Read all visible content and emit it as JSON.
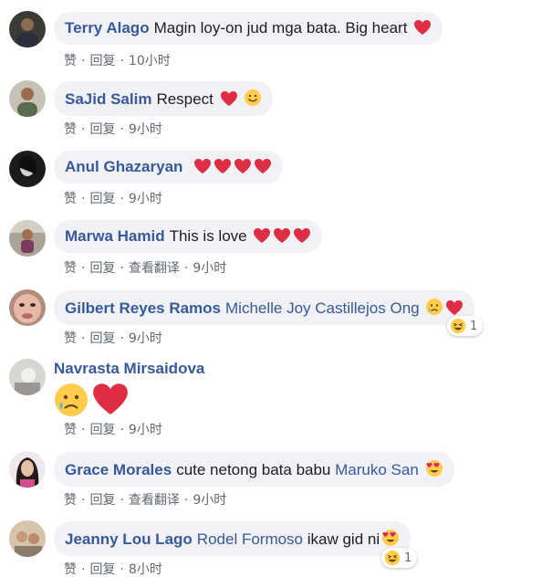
{
  "actions": {
    "like": "赞",
    "reply": "回复",
    "translate": "查看翻译",
    "sep": "·"
  },
  "comments": [
    {
      "author": "Terry Alago",
      "text": "Magin loy-on jud mga bata. Big heart",
      "emojis": [
        "heart"
      ],
      "time": "10小时"
    },
    {
      "author": "SaJid Salim",
      "text": "Respect",
      "emojis": [
        "heart",
        "smile"
      ],
      "time": "9小时"
    },
    {
      "author": "Anul Ghazaryan",
      "text": "",
      "emojis": [
        "heart",
        "heart",
        "heart",
        "heart"
      ],
      "time": "9小时"
    },
    {
      "author": "Marwa Hamid",
      "text": "This is love",
      "emojis": [
        "heart",
        "heart",
        "heart"
      ],
      "time": "9小时",
      "translate": true
    },
    {
      "author": "Gilbert Reyes Ramos",
      "mention": "Michelle Joy Castillejos Ong",
      "emojis": [
        "sad-tear",
        "heart"
      ],
      "time": "9小时",
      "reaction": {
        "icon": "laugh",
        "count": "1"
      }
    },
    {
      "author": "Navrasta Mirsaidova",
      "big_emojis": [
        "sad-tear",
        "heart"
      ],
      "time": "9小时"
    },
    {
      "author": "Grace Morales",
      "text": "cute netong bata babu",
      "mention": "Maruko San",
      "emojis": [
        "heart-eyes"
      ],
      "time": "9小时",
      "translate": true
    },
    {
      "author": "Jeanny Lou Lago",
      "mention": "Rodel Formoso",
      "text": "ikaw gid ni",
      "emojis": [
        "heart-eyes"
      ],
      "time": "8小时",
      "reaction": {
        "icon": "laugh",
        "count": "1"
      }
    }
  ]
}
